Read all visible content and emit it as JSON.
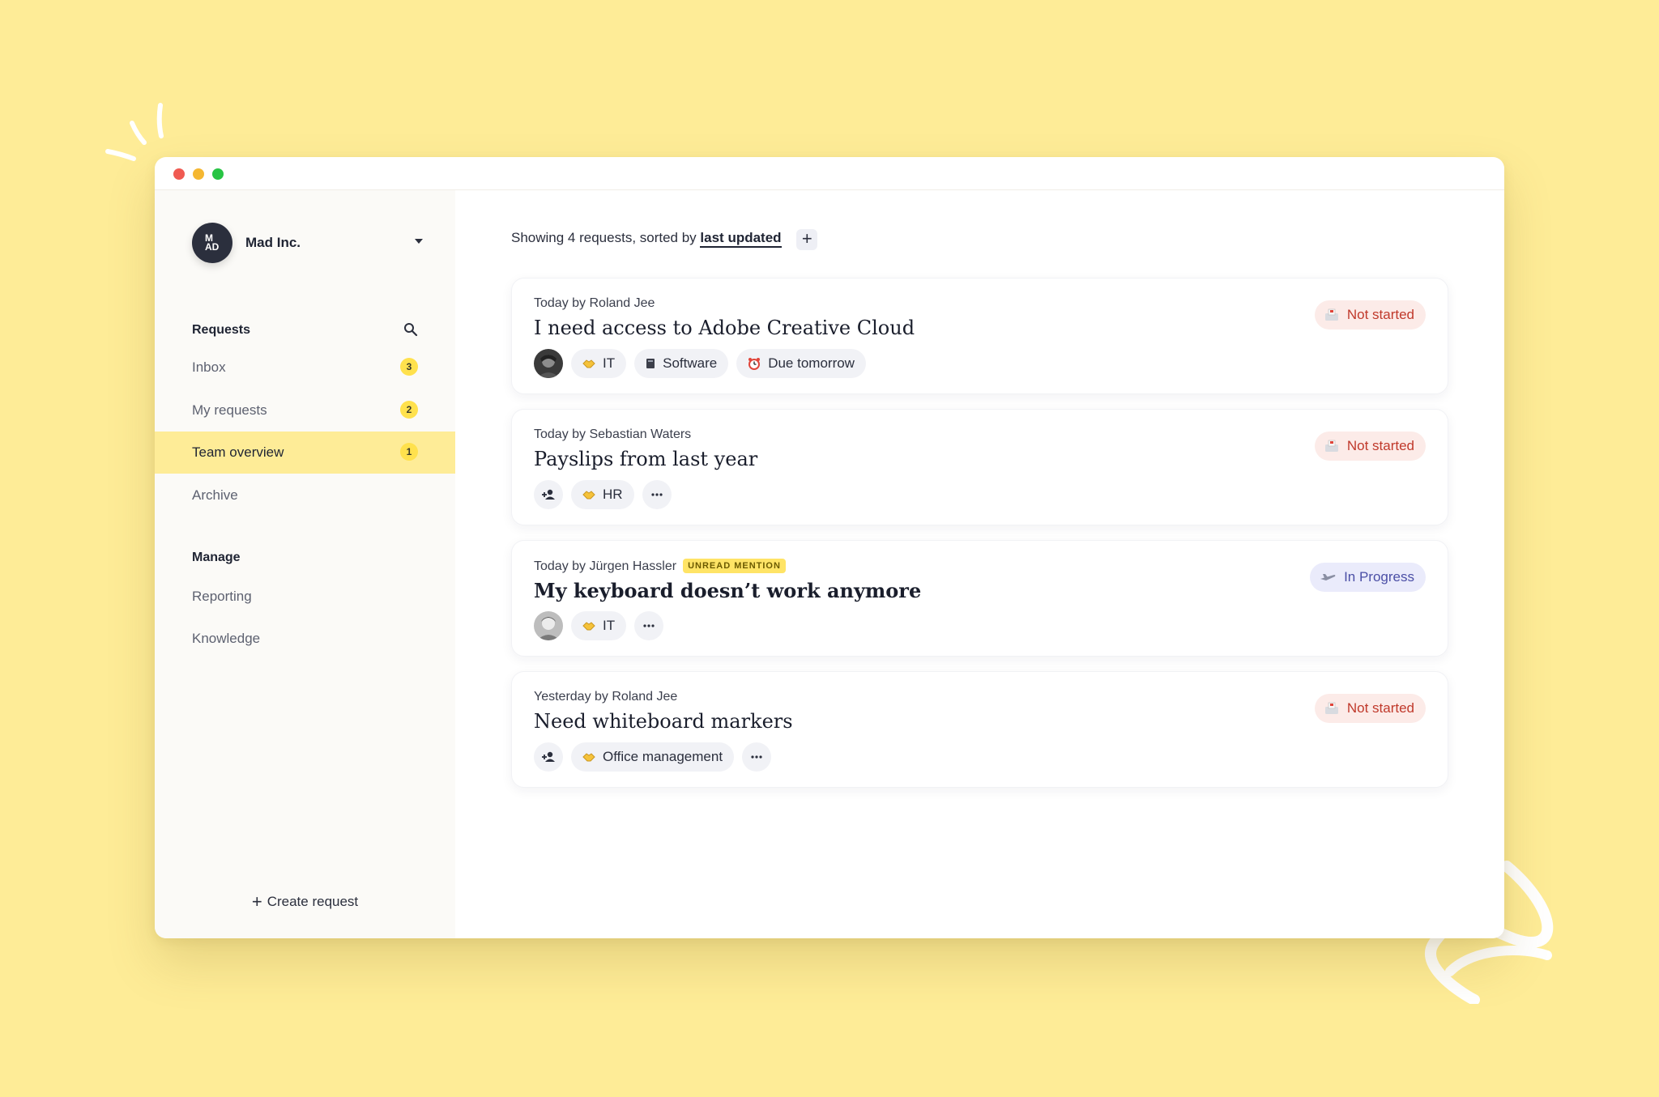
{
  "colors": {
    "background": "#FEEC97",
    "active_nav": "#FEEC97",
    "badge": "#FFE14D",
    "not_started_bg": "#FCEBE8",
    "not_started_text": "#C0392B",
    "in_progress_bg": "#EAEBFB",
    "in_progress_text": "#4B4FA6"
  },
  "window": {
    "controls": [
      "close",
      "minimize",
      "maximize"
    ]
  },
  "sidebar": {
    "org": {
      "name": "Mad Inc.",
      "logo_text": "MAD"
    },
    "requests_title": "Requests",
    "nav": [
      {
        "label": "Inbox",
        "badge": "3"
      },
      {
        "label": "My requests",
        "badge": "2"
      },
      {
        "label": "Team overview",
        "badge": "1",
        "active": true
      },
      {
        "label": "Archive"
      }
    ],
    "manage_title": "Manage",
    "manage": [
      {
        "label": "Reporting"
      },
      {
        "label": "Knowledge"
      }
    ],
    "create_label": "Create request"
  },
  "main": {
    "summary_prefix": "Showing 4 requests, sorted by",
    "sort_label": "last updated",
    "requests": [
      {
        "meta": "Today by Roland Jee",
        "title": "I need access to Adobe Creative Cloud",
        "status": "Not started",
        "assignee": "avatar",
        "tags": [
          {
            "icon": "handshake-icon",
            "label": "IT"
          },
          {
            "icon": "book-icon",
            "label": "Software"
          },
          {
            "icon": "alarm-clock-icon",
            "label": "Due tomorrow"
          }
        ]
      },
      {
        "meta": "Today by Sebastian Waters",
        "title": "Payslips from last year",
        "status": "Not started",
        "assignee": "add-person-icon",
        "tags": [
          {
            "icon": "handshake-icon",
            "label": "HR"
          }
        ]
      },
      {
        "meta": "Today by Jürgen Hassler",
        "mention": "UNREAD MENTION",
        "title": "My keyboard doesn’t work anymore",
        "status": "In Progress",
        "assignee": "avatar",
        "tags": [
          {
            "icon": "handshake-icon",
            "label": "IT"
          }
        ]
      },
      {
        "meta": "Yesterday by Roland Jee",
        "title": "Need whiteboard markers",
        "status": "Not started",
        "assignee": "add-person-icon",
        "tags": [
          {
            "icon": "handshake-icon",
            "label": "Office management"
          }
        ]
      }
    ]
  }
}
